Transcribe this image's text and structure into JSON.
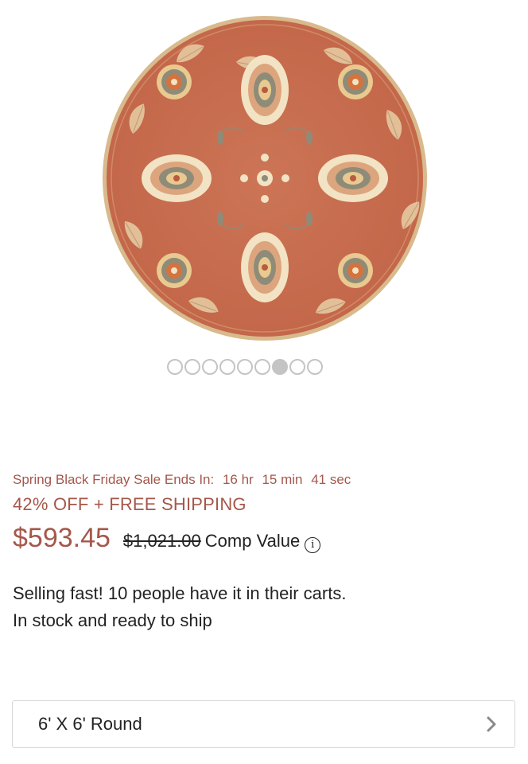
{
  "product": {
    "image_alt": "Round orange floral rug",
    "colors": {
      "rug_base": "#c96d4f",
      "rug_border": "#dbbd8f",
      "motif_cream": "#f2e3c4",
      "motif_gray": "#8e8c78"
    }
  },
  "carousel": {
    "total": 9,
    "active_index": 7
  },
  "sale": {
    "label": "Spring Black Friday Sale Ends In:",
    "hours": "16 hr",
    "minutes": "15 min",
    "seconds": "41 sec",
    "offer": "42% OFF + FREE SHIPPING"
  },
  "pricing": {
    "price": "$593.45",
    "comp_price": "$1,021.00",
    "comp_label": "Comp Value",
    "info_icon": "i",
    "accent_color": "#a5574a"
  },
  "availability": {
    "urgency": "Selling fast! 10 people have it in their carts.",
    "stock": "In stock and ready to ship"
  },
  "size": {
    "selected": "6' X 6' Round",
    "chevron_icon": "chevron-right-icon"
  }
}
